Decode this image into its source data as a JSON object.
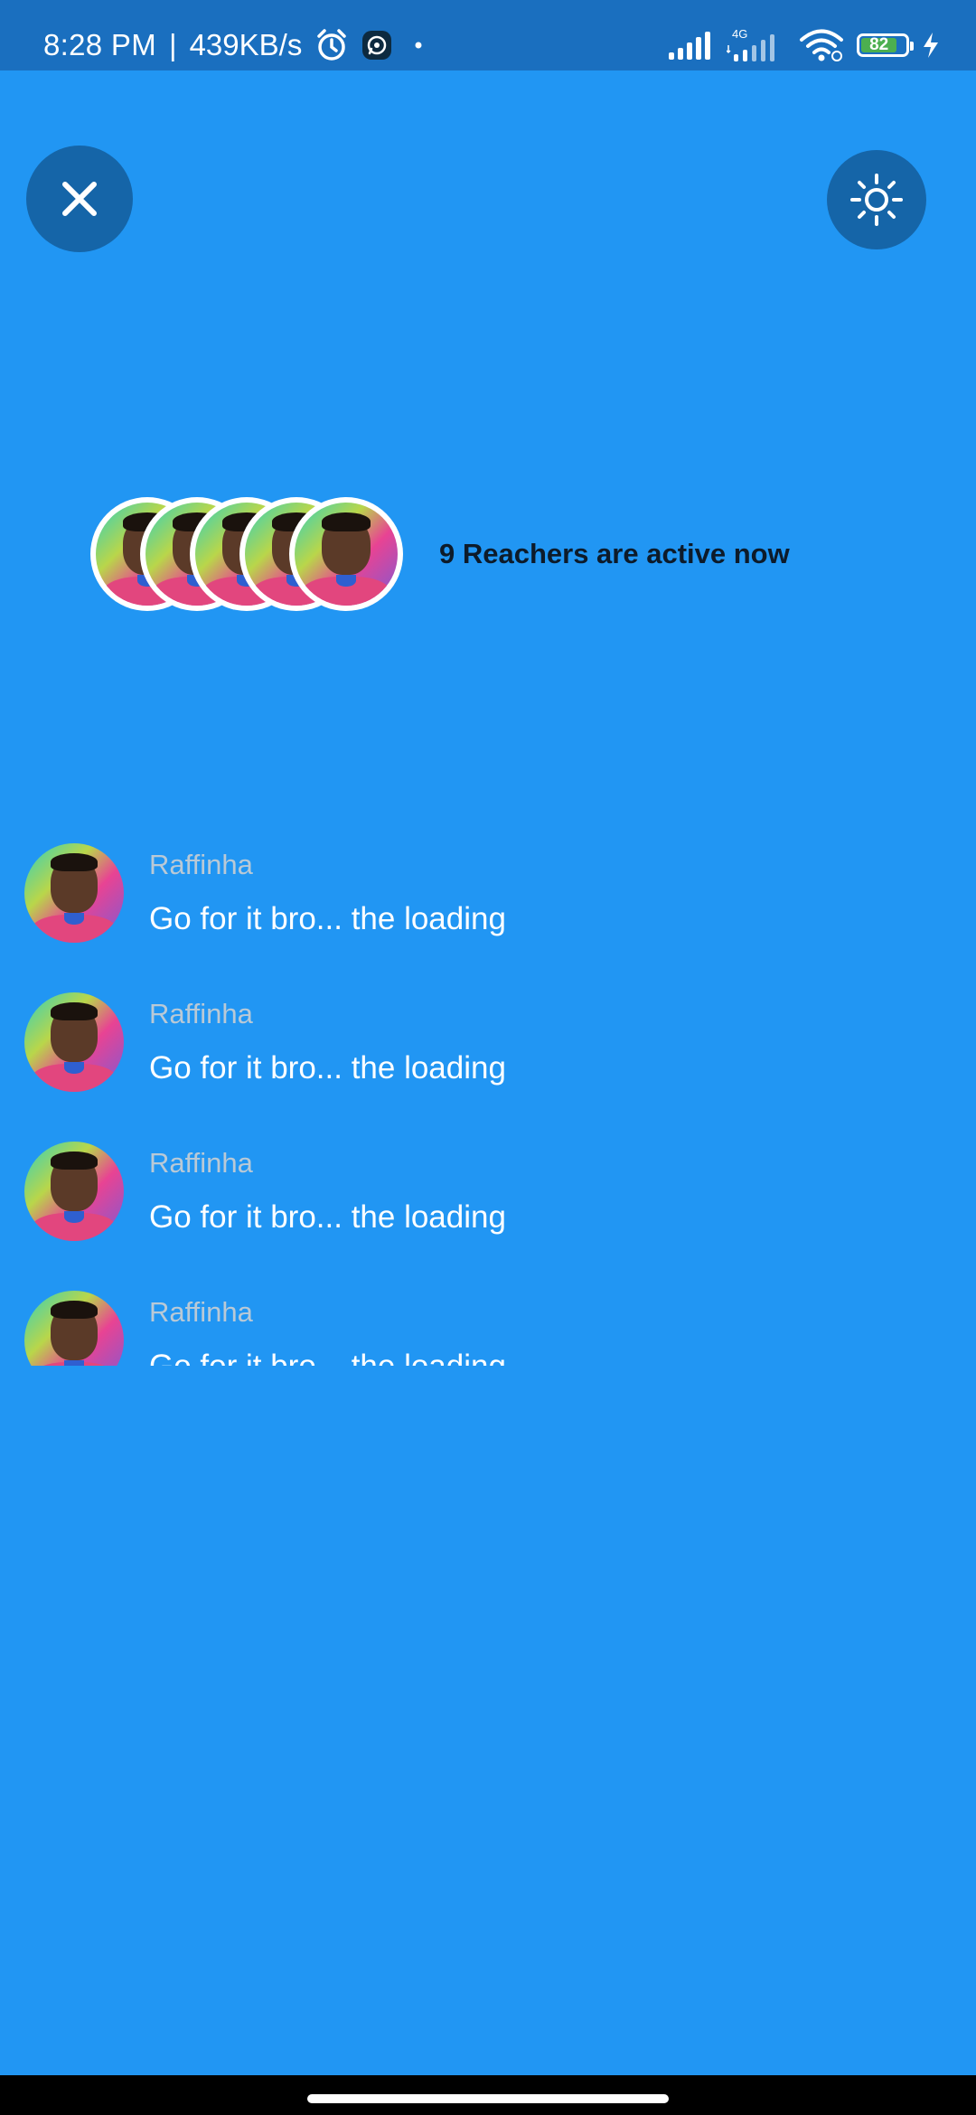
{
  "status_bar": {
    "time": "8:28 PM",
    "separator": "|",
    "speed": "439KB/s",
    "network_label": "4G",
    "battery_level": "82",
    "battery_fraction": 0.82
  },
  "controls": {
    "close_icon": "close-icon",
    "brightness_icon": "sun-icon"
  },
  "active": {
    "text": "9 Reachers are active now",
    "stack_count": 5
  },
  "messages": [
    {
      "name": "Raffinha",
      "text": "Go for it bro... the loading"
    },
    {
      "name": "Raffinha",
      "text": "Go for it bro... the loading"
    },
    {
      "name": "Raffinha",
      "text": "Go for it bro... the loading"
    },
    {
      "name": "Raffinha",
      "text": "Go for it bro... the loading"
    }
  ],
  "colors": {
    "background": "#2196f3",
    "status_bar": "#1a6fbf",
    "button": "#1565a8",
    "name_text": "#b9c9d6",
    "battery": "#4caf50"
  }
}
